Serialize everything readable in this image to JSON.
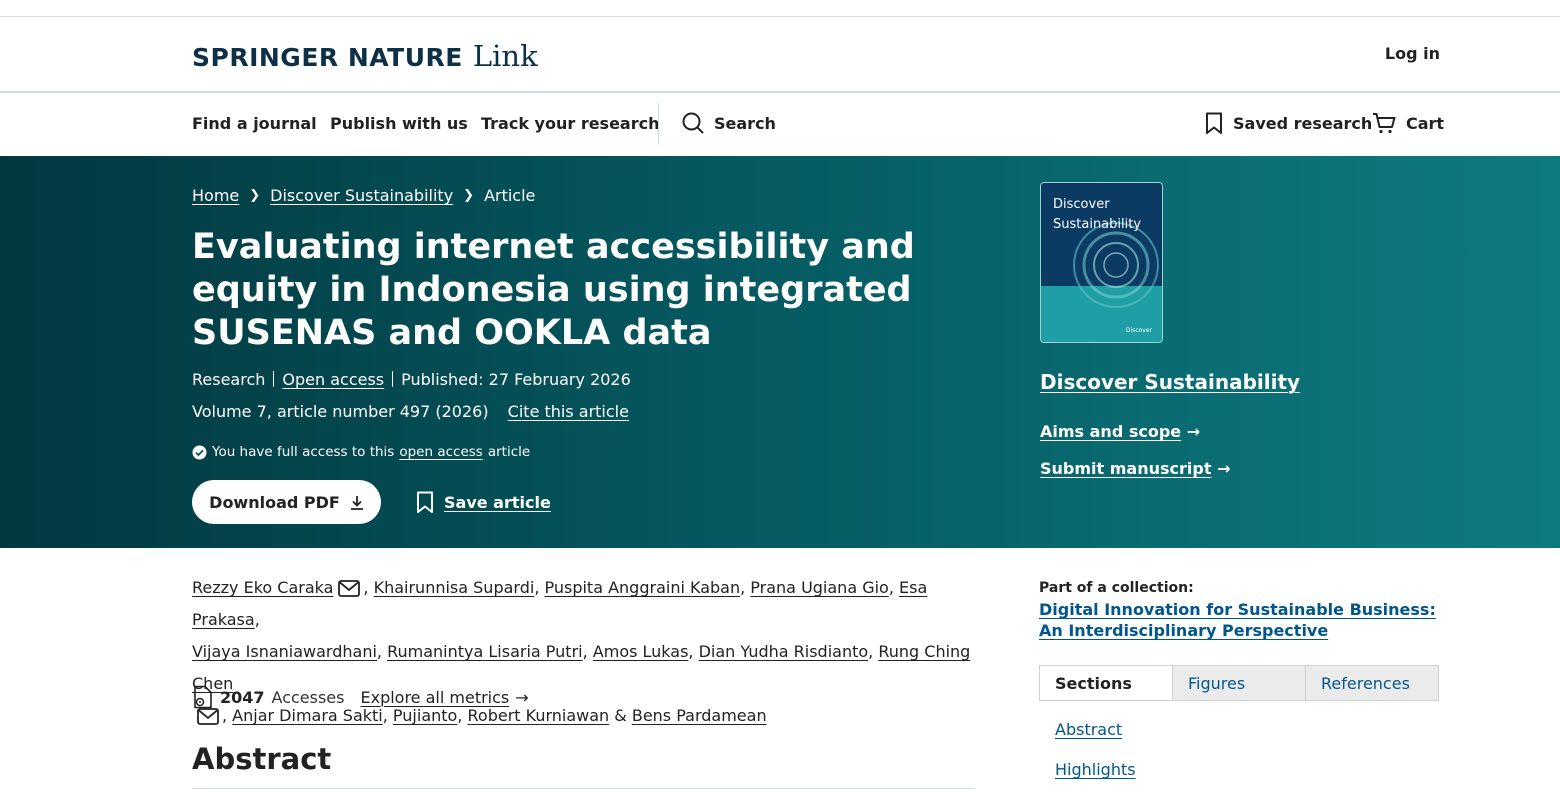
{
  "header": {
    "brand": "SPRINGER NATURE",
    "brand_sub": "Link",
    "login": "Log in"
  },
  "nav": {
    "find_journal": "Find a journal",
    "publish": "Publish with us",
    "track": "Track your research",
    "search": "Search",
    "saved": "Saved research",
    "cart": "Cart"
  },
  "breadcrumb": {
    "home": "Home",
    "journal": "Discover Sustainability",
    "current": "Article"
  },
  "article": {
    "title": "Evaluating internet accessibility and equity in Indonesia using integrated SUSENAS and OOKLA data",
    "type": "Research",
    "open_access": "Open access",
    "published": "Published: 27 February 2026",
    "volume": "Volume 7, article number 497 (2026)",
    "cite": "Cite this article",
    "access_prefix": "You have full access to this",
    "access_link": "open access",
    "access_suffix": "article",
    "download": "Download PDF",
    "save": "Save article"
  },
  "journal": {
    "cover_line1": "Discover",
    "cover_line2": "Sustainability",
    "cover_logo": "Discover",
    "name": "Discover Sustainability",
    "aims": "Aims and scope",
    "submit": "Submit manuscript"
  },
  "authors": [
    "Rezzy Eko Caraka",
    "Khairunnisa Supardi",
    "Puspita Anggraini Kaban",
    "Prana Ugiana Gio",
    "Esa Prakasa",
    "Vijaya Isnaniawardhani",
    "Rumanintya Lisaria Putri",
    "Amos Lukas",
    "Dian Yudha Risdianto",
    "Rung Ching Chen",
    "Anjar Dimara Sakti",
    "Pujianto",
    "Robert Kurniawan",
    "Bens Pardamean"
  ],
  "metrics": {
    "count": "2047",
    "label": "Accesses",
    "explore": "Explore all metrics"
  },
  "abstract_heading": "Abstract",
  "collection": {
    "label": "Part of a collection:",
    "link": "Digital Innovation for Sustainable Business: An Interdisciplinary Perspective"
  },
  "tabs": [
    "Sections",
    "Figures",
    "References"
  ],
  "sections": [
    "Abstract",
    "Highlights"
  ],
  "colors": {
    "hero_dark": "#03373e",
    "hero_light": "#0d7a80",
    "link_blue": "#01568b",
    "brand_navy": "#0b3048"
  }
}
